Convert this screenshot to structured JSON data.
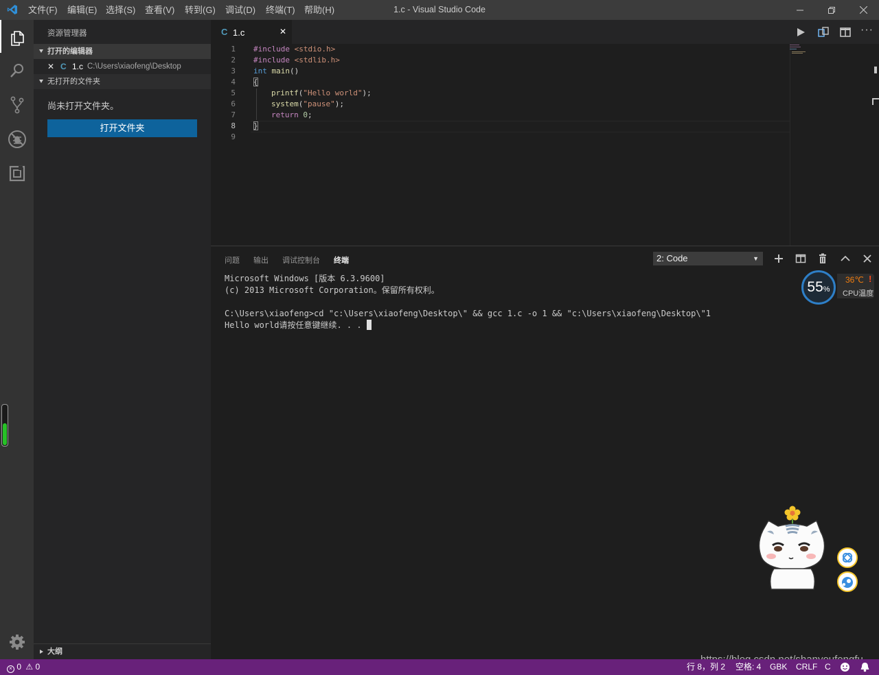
{
  "titlebar": {
    "menus": [
      "文件(F)",
      "编辑(E)",
      "选择(S)",
      "查看(V)",
      "转到(G)",
      "调试(D)",
      "终端(T)",
      "帮助(H)"
    ],
    "title": "1.c - Visual Studio Code"
  },
  "sidebar": {
    "header": "资源管理器",
    "open_editors_title": "打开的编辑器",
    "open_editor_item": {
      "icon_label": "C",
      "name": "1.c",
      "path": "C:\\Users\\xiaofeng\\Desktop"
    },
    "no_folder_title": "无打开的文件夹",
    "no_folder_message": "尚未打开文件夹。",
    "open_folder_button": "打开文件夹",
    "outline_title": "大纲"
  },
  "editor": {
    "tab": {
      "icon_label": "C",
      "name": "1.c"
    },
    "line_numbers": [
      "1",
      "2",
      "3",
      "4",
      "5",
      "6",
      "7",
      "8",
      "9"
    ],
    "code": {
      "l1_pp": "#include",
      "l1_hdr": "<stdio.h>",
      "l2_pp": "#include",
      "l2_hdr": "<stdlib.h>",
      "l3_type": "int",
      "l3_fn": "main",
      "l3_rest": "()",
      "l4": "{",
      "l5_fn": "printf",
      "l5_open": "(",
      "l5_str": "\"Hello world\"",
      "l5_close": ");",
      "l6_fn": "system",
      "l6_open": "(",
      "l6_str": "\"pause\"",
      "l6_close": ");",
      "l7_kw": "return",
      "l7_num": "0",
      "l7_end": ";",
      "l8": "}"
    },
    "active_line": 8
  },
  "panel": {
    "tabs": [
      "问题",
      "输出",
      "调试控制台",
      "终端"
    ],
    "active_tab": "终端",
    "terminal_select": "2: Code",
    "terminal_lines": [
      "Microsoft Windows [版本 6.3.9600]",
      "(c) 2013 Microsoft Corporation。保留所有权利。",
      "",
      "C:\\Users\\xiaofeng>cd \"c:\\Users\\xiaofeng\\Desktop\\\" && gcc 1.c -o 1 && \"c:\\Users\\xiaofeng\\Desktop\\\"1",
      "Hello world请按任意键继续. . . "
    ]
  },
  "cpu_widget": {
    "percent": "55",
    "percent_unit": "%",
    "temperature": "36℃",
    "label": "CPU温度",
    "warning": "!"
  },
  "statusbar": {
    "errors": "0",
    "warnings": "0",
    "position": "行 8，列 2",
    "spaces": "空格: 4",
    "encoding": "GBK",
    "eol": "CRLF",
    "language": "C"
  },
  "watermark": "https://blog.csdn.net/shanyoufengfu",
  "colors": {
    "statusbar": "#68217a",
    "activitybar": "#333333",
    "sidebar": "#252526",
    "editor": "#1e1e1e",
    "button": "#0e639c"
  }
}
